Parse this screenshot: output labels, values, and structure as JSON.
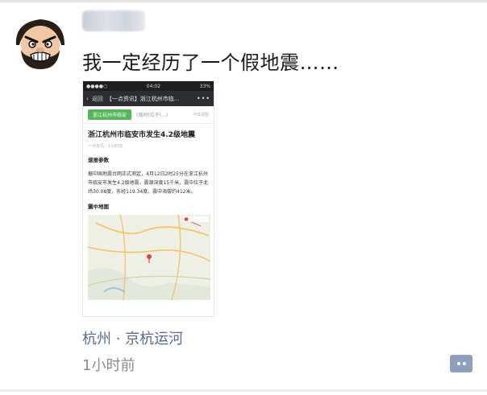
{
  "post": {
    "username": "",
    "text": "我一定经历了一个假地震……",
    "location": "杭州 · 京杭运河",
    "time": "1小时前"
  },
  "shared_screenshot": {
    "status_time": "04:02",
    "status_battery": "33%",
    "nav_back": "返回",
    "nav_title": "【一点资讯】浙江杭州市临...",
    "nav_more": "•••",
    "tabs": [
      "浙江杭州市临安",
      "(临时)位于(...)",
      "字体调整"
    ],
    "title": "浙江杭州市临安市发生4.2级地震",
    "meta": "一点资讯 · 1小时前",
    "section_basic": "速报参数",
    "body": "据中国地震台网正式测定，4月12日2时25分在浙江杭州市临安市发生4.2级地震，震源深度15千米，震中位于北纬30.08度，东经119.34度。震中海拔约412米。",
    "section_map": "震中地图"
  },
  "colors": {
    "link": "#576b95",
    "muted": "#8a8a8a",
    "comment_button": "#8fa0bf"
  },
  "icons": {
    "avatar": "cartoon-bearded-man",
    "comment": "comment-dots-icon"
  }
}
